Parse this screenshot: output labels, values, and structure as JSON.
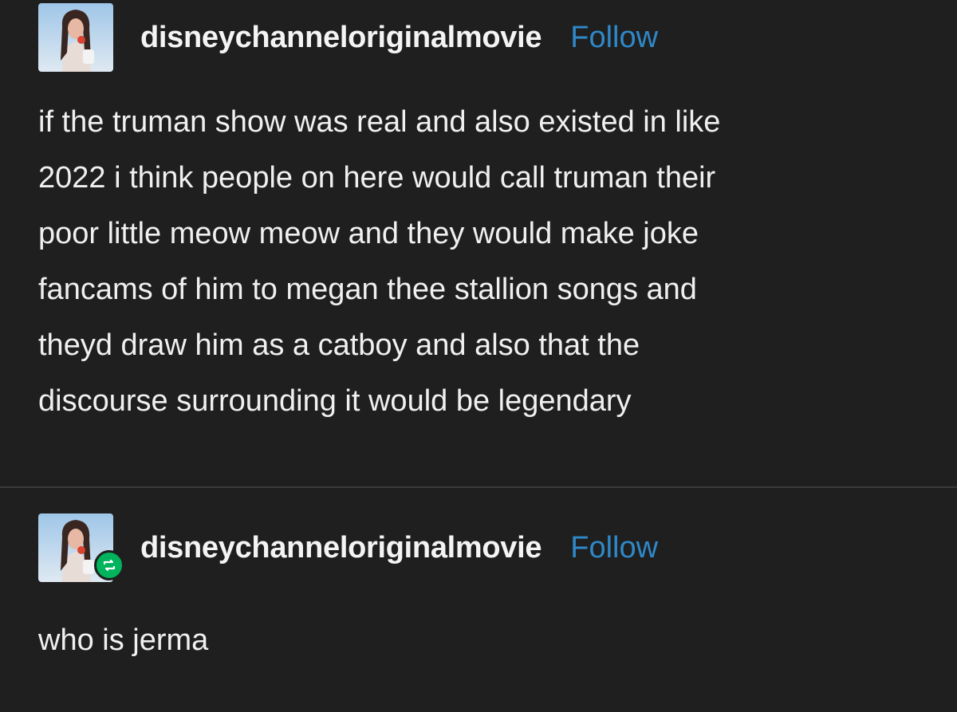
{
  "posts": [
    {
      "username": "disneychanneloriginalmovie",
      "follow_label": "Follow",
      "reblogged": false,
      "lines": [
        "if the truman show was real and also existed in like",
        "2022 i think people on here would call truman their",
        "poor little meow meow and they would make joke",
        "fancams of him to megan thee stallion songs and",
        "theyd draw him as a catboy and also that the",
        "discourse surrounding it would be legendary"
      ]
    },
    {
      "username": "disneychanneloriginalmovie",
      "follow_label": "Follow",
      "reblogged": true,
      "lines": [
        "who is jerma"
      ]
    }
  ],
  "colors": {
    "background": "#1f1f1f",
    "text": "#f0f0f0",
    "follow_link": "#2f88c8",
    "reblog_badge": "#00b35c",
    "divider": "#3a3a3a"
  },
  "icons": {
    "avatar": "avatar-icon",
    "reblog": "reblog-icon"
  }
}
